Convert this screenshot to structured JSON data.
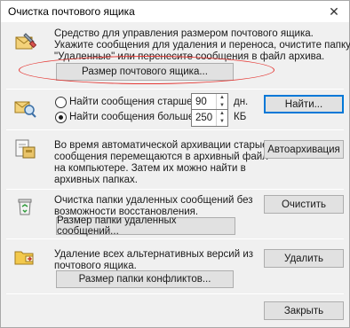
{
  "window": {
    "title": "Очистка почтового ящика",
    "close_glyph": "✕"
  },
  "mailbox_size": {
    "line1": "Средство для управления размером почтового ящика.",
    "line2": "Укажите сообщения для удаления и переноса, очистите папку",
    "line3": "\"Удаленные\" или перенесите сообщения в файл архива.",
    "button": "Размер почтового ящика..."
  },
  "find": {
    "older_label": "Найти сообщения старше",
    "older_value": "90",
    "older_unit": "дн.",
    "larger_label": "Найти сообщения больше",
    "larger_value": "250",
    "larger_unit": "КБ",
    "button": "Найти...",
    "selected": "larger"
  },
  "autoarchive": {
    "line1": "Во время автоматической архивации старые",
    "line2": "сообщения перемещаются в архивный файл",
    "line3": "на компьютере. Затем их можно найти в",
    "line4": "архивных папках.",
    "button": "Автоархивация"
  },
  "deleted": {
    "line1": "Очистка папки удаленных сообщений без",
    "line2": "возможности восстановления.",
    "size_button": "Размер папки удаленных сообщений...",
    "clear_button": "Очистить"
  },
  "conflicts": {
    "line1": "Удаление всех альтернативных версий из",
    "line2": "почтового ящика.",
    "size_button": "Размер папки конфликтов...",
    "delete_button": "Удалить"
  },
  "footer": {
    "close_button": "Закрыть"
  },
  "colors": {
    "accent": "#0078d7",
    "highlight": "#e53935"
  }
}
